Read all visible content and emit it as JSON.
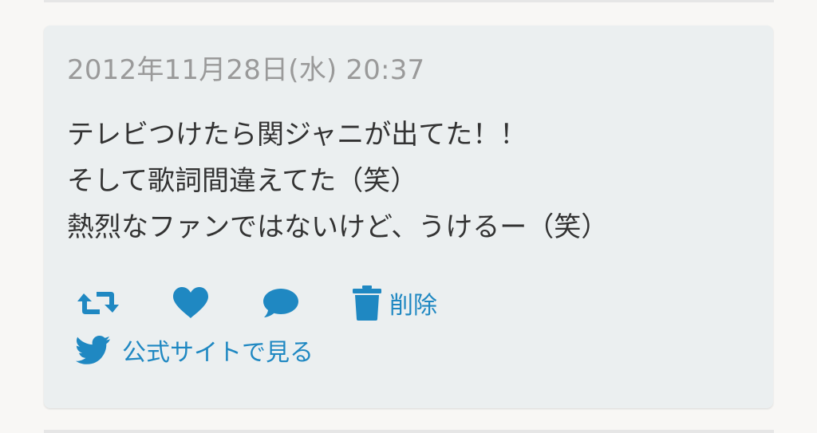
{
  "post": {
    "timestamp": "2012年11月28日(水) 20:37",
    "lines": [
      "テレビつけたら関ジャニが出てた！！",
      "そして歌詞間違えてた（笑）",
      "熱烈なファンではないけど、うけるー（笑）"
    ]
  },
  "actions": {
    "retweet_icon": "retweet-icon",
    "like_icon": "heart-icon",
    "reply_icon": "speech-bubble-icon",
    "delete_icon": "trash-icon",
    "delete_label": "削除",
    "site_icon": "twitter-bird-icon",
    "site_label": "公式サイトで見る"
  },
  "colors": {
    "accent": "#1f88c2",
    "card_bg": "#ebeff0",
    "timestamp": "#9a9a9a",
    "text": "#333333"
  }
}
